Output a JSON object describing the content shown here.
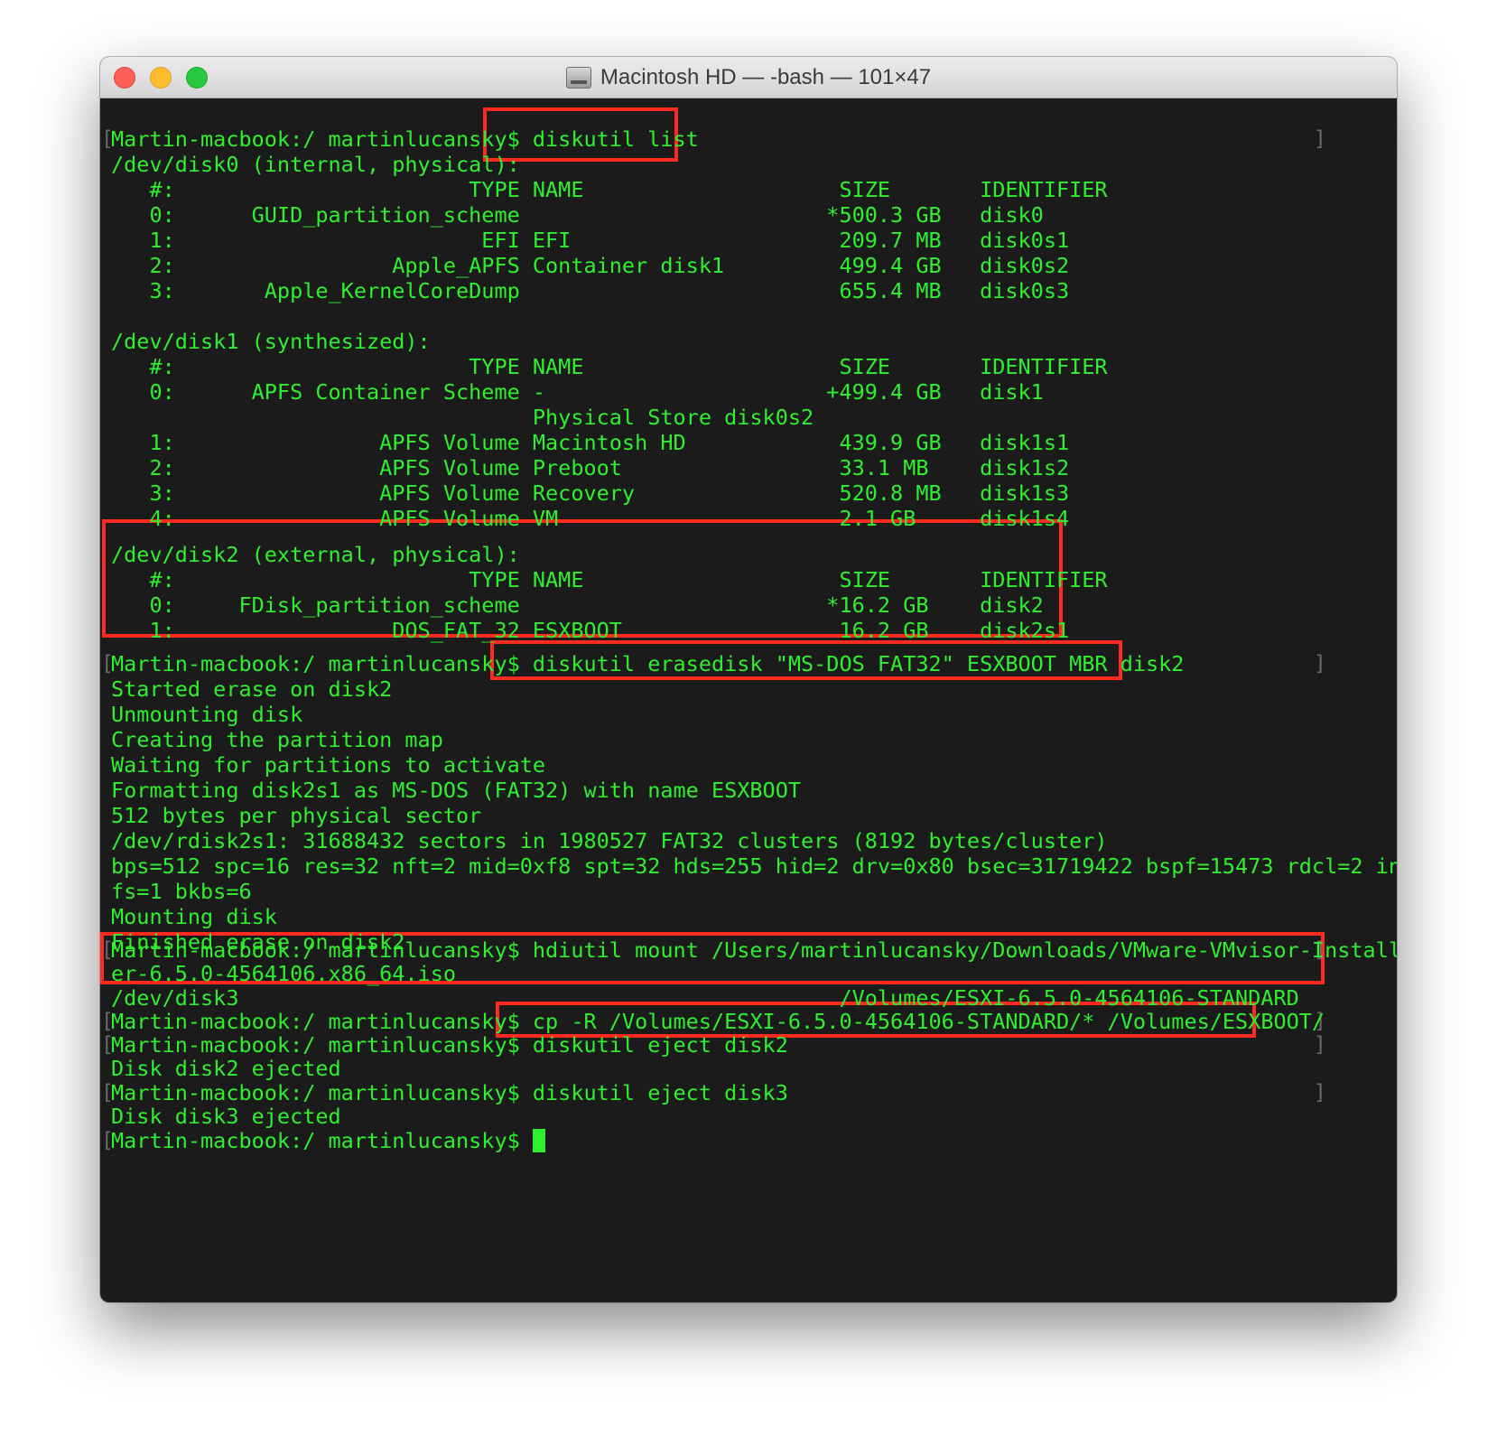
{
  "window": {
    "title": "Macintosh HD — -bash — 101×47"
  },
  "terminal": {
    "lines": [
      "Martin-macbook:/ martinlucansky$ diskutil list",
      "/dev/disk0 (internal, physical):",
      "   #:                       TYPE NAME                    SIZE       IDENTIFIER",
      "   0:      GUID_partition_scheme                        *500.3 GB   disk0",
      "   1:                        EFI EFI                     209.7 MB   disk0s1",
      "   2:                 Apple_APFS Container disk1         499.4 GB   disk0s2",
      "   3:       Apple_KernelCoreDump                         655.4 MB   disk0s3",
      "",
      "/dev/disk1 (synthesized):",
      "   #:                       TYPE NAME                    SIZE       IDENTIFIER",
      "   0:      APFS Container Scheme -                      +499.4 GB   disk1",
      "                                 Physical Store disk0s2",
      "   1:                APFS Volume Macintosh HD            439.9 GB   disk1s1",
      "   2:                APFS Volume Preboot                 33.1 MB    disk1s2",
      "   3:                APFS Volume Recovery                520.8 MB   disk1s3",
      "   4:                APFS Volume VM                      2.1 GB     disk1s4",
      "",
      "/dev/disk2 (external, physical):",
      "   #:                       TYPE NAME                    SIZE       IDENTIFIER",
      "   0:     FDisk_partition_scheme                        *16.2 GB    disk2",
      "   1:                 DOS_FAT_32 ESXBOOT                 16.2 GB    disk2s1",
      "",
      "Martin-macbook:/ martinlucansky$ diskutil erasedisk \"MS-DOS FAT32\" ESXBOOT MBR disk2",
      "Started erase on disk2",
      "Unmounting disk",
      "Creating the partition map",
      "Waiting for partitions to activate",
      "Formatting disk2s1 as MS-DOS (FAT32) with name ESXBOOT",
      "512 bytes per physical sector",
      "/dev/rdisk2s1: 31688432 sectors in 1980527 FAT32 clusters (8192 bytes/cluster)",
      "bps=512 spc=16 res=32 nft=2 mid=0xf8 spt=32 hds=255 hid=2 drv=0x80 bsec=31719422 bspf=15473 rdcl=2 in",
      "fs=1 bkbs=6",
      "Mounting disk",
      "Finished erase on disk2",
      "Martin-macbook:/ martinlucansky$ hdiutil mount /Users/martinlucansky/Downloads/VMware-VMvisor-Install",
      "er-6.5.0-4564106.x86_64.iso",
      "/dev/disk3                                               /Volumes/ESXI-6.5.0-4564106-STANDARD",
      "Martin-macbook:/ martinlucansky$ cp -R /Volumes/ESXI-6.5.0-4564106-STANDARD/* /Volumes/ESXBOOT/",
      "Martin-macbook:/ martinlucansky$ diskutil eject disk2",
      "Disk disk2 ejected",
      "Martin-macbook:/ martinlucansky$ diskutil eject disk3",
      "Disk disk3 ejected",
      "Martin-macbook:/ martinlucansky$ "
    ],
    "left_brackets": [
      "[",
      "[",
      "[",
      "[",
      "[",
      "[",
      "["
    ],
    "right_brackets": [
      "]",
      "]",
      "]",
      "]",
      "]",
      "]",
      "]"
    ]
  },
  "colors": {
    "text": "#2fef2f",
    "background": "#1b1b1b",
    "highlight": "#ff2a1f"
  }
}
